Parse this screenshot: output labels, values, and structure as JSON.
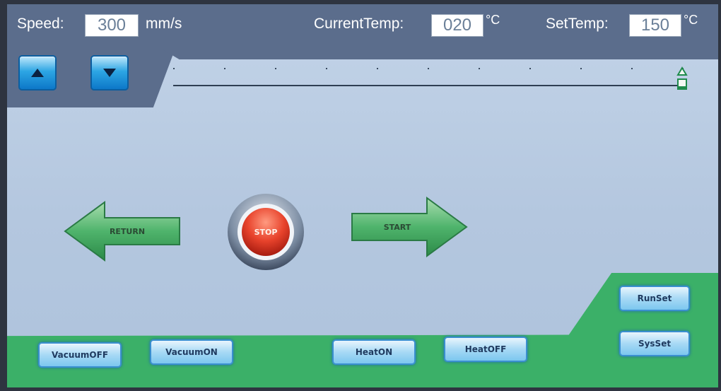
{
  "header": {
    "speed_label": "Speed:",
    "speed_value": "300",
    "speed_unit": "mm/s",
    "current_temp_label": "CurrentTemp:",
    "current_temp_value": "020",
    "current_temp_unit": "°C",
    "set_temp_label": "SetTemp:",
    "set_temp_value": "150",
    "set_temp_unit": "°C"
  },
  "controls": {
    "up_icon": "triangle-up",
    "down_icon": "triangle-down",
    "slider_level": 1.0
  },
  "motion": {
    "return_label": "RETURN",
    "stop_label": "STOP",
    "start_label": "START"
  },
  "bottom": {
    "vacuum_off": "VacuumOFF",
    "vacuum_on": "VacuumON",
    "heat_on": "HeatON",
    "heat_off": "HeatOFF",
    "run_set": "RunSet",
    "sys_set": "SysSet"
  },
  "colors": {
    "header_bg": "#5b6d8c",
    "screen_bg": "#c3d4e8",
    "green_area": "#3bb068",
    "stop_red": "#e8432c",
    "arrow_green": "#3aa55e"
  }
}
